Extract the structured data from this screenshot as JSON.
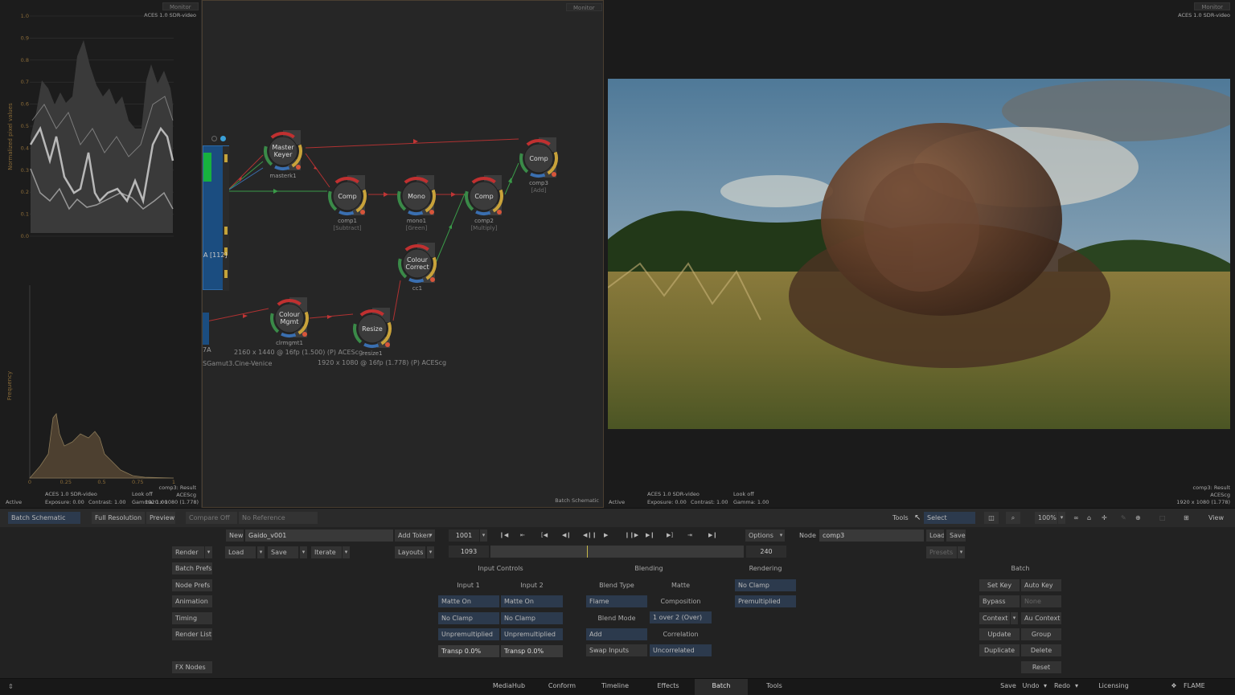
{
  "scopes": {
    "monitor_label": "Monitor",
    "colorspace": "ACES 1.0 SDR-video",
    "waveform_ylabel": "Normalized pixel values",
    "waveform_ticks": [
      "1.0",
      "0.9",
      "0.8",
      "0.7",
      "0.6",
      "0.5",
      "0.4",
      "0.3",
      "0.2",
      "0.1",
      "0.0"
    ],
    "histogram_ylabel": "Frequency",
    "histogram_ticks": [
      "0",
      "0.25",
      "0.5",
      "0.75",
      "1"
    ],
    "footer": {
      "result": "comp3: Result",
      "colorspace": "ACES 1.0 SDR-video",
      "look": "Look off",
      "aces": "ACEScg",
      "exposure": "Exposure: 0.00",
      "contrast": "Contrast: 1.00",
      "gamma": "Gamma: 1.00",
      "resolution": "1920 x 1080 (1.778)",
      "status": "Active"
    }
  },
  "schematic": {
    "monitor_label": "Monitor",
    "title": "Batch Schematic",
    "nodes": [
      {
        "name": "Master\nKeyer",
        "label": "masterk1",
        "sub": ""
      },
      {
        "name": "Comp",
        "label": "comp1",
        "sub": "[Subtract]"
      },
      {
        "name": "Mono",
        "label": "mono1",
        "sub": "[Green]"
      },
      {
        "name": "Comp",
        "label": "comp2",
        "sub": "[Multiply]"
      },
      {
        "name": "Comp",
        "label": "comp3",
        "sub": "[Add]"
      },
      {
        "name": "Colour\nCorrect",
        "label": "cc1",
        "sub": ""
      },
      {
        "name": "Colour\nMgmt",
        "label": "clrmgmt1",
        "sub": ""
      },
      {
        "name": "Resize",
        "label": "resize1",
        "sub": ""
      }
    ],
    "clip_label": "A [112]",
    "clip2_label": "7A",
    "info1": "2160 x 1440 @ 16fp (1.500) (P) ACEScg",
    "info2": "1920 x 1080 @ 16fp (1.778) (P) ACEScg",
    "info3": "SGamut3.Cine-Venice"
  },
  "viewer": {
    "monitor_label": "Monitor",
    "colorspace": "ACES 1.0 SDR-video",
    "footer": {
      "colorspace": "ACES 1.0 SDR-video",
      "look": "Look off",
      "exposure": "Exposure: 0.00",
      "contrast": "Contrast: 1.00",
      "gamma": "Gamma: 1.00",
      "status": "Active",
      "result": "comp3: Result",
      "aces": "ACEScg",
      "resolution": "1920 x 1080 (1.778)"
    }
  },
  "view_bar": {
    "batch_schematic": "Batch Schematic",
    "full_resolution": "Full Resolution",
    "preview": "Preview",
    "compare": "Compare Off",
    "reference": "No Reference",
    "tools": "Tools",
    "select": "Select",
    "zoom": "100%",
    "view": "View"
  },
  "controls": {
    "new": "New",
    "setup_name": "Gaido_v001",
    "add_token": "Add Token",
    "frame": "1001",
    "options": "Options",
    "node_label": "Node",
    "node_name": "comp3",
    "load": "Load",
    "save": "Save",
    "render": "Render",
    "load2": "Load",
    "save2": "Save",
    "iterate": "Iterate",
    "layouts": "Layouts",
    "start_frame": "1093",
    "end_frame": "240",
    "presets": "Presets",
    "left_menu": [
      "Batch Prefs",
      "Node Prefs",
      "Animation",
      "Timing",
      "Render List"
    ],
    "fx_nodes": "FX Nodes",
    "input_controls": {
      "title": "Input Controls",
      "input1": "Input 1",
      "input2": "Input 2",
      "rows1": [
        "Matte On",
        "No Clamp",
        "Unpremultiplied",
        "Transp 0.0%"
      ],
      "rows2": [
        "Matte On",
        "No Clamp",
        "Unpremultiplied",
        "Transp 0.0%"
      ]
    },
    "blending": {
      "title": "Blending",
      "blend_type": "Blend Type",
      "matte": "Matte",
      "flame": "Flame",
      "composition": "Composition",
      "blend_mode": "Blend Mode",
      "over": "1 over 2 (Over)",
      "add": "Add",
      "correlation": "Correlation",
      "swap": "Swap Inputs",
      "uncorrelated": "Uncorrelated"
    },
    "rendering": {
      "title": "Rendering",
      "no_clamp": "No Clamp",
      "premultiplied": "Premultiplied"
    },
    "batch": {
      "title": "Batch",
      "set_key": "Set Key",
      "auto_key": "Auto Key",
      "bypass": "Bypass",
      "none": "None",
      "context": "Context",
      "au_context": "Au Context",
      "update": "Update",
      "group": "Group",
      "duplicate": "Duplicate",
      "delete": "Delete",
      "reset": "Reset"
    }
  },
  "tabs": {
    "items": [
      "MediaHub",
      "Conform",
      "Timeline",
      "Effects",
      "Batch",
      "Tools"
    ],
    "active": "Batch",
    "save": "Save",
    "undo": "Undo",
    "redo": "Redo",
    "licensing": "Licensing",
    "brand": "FLAME"
  }
}
